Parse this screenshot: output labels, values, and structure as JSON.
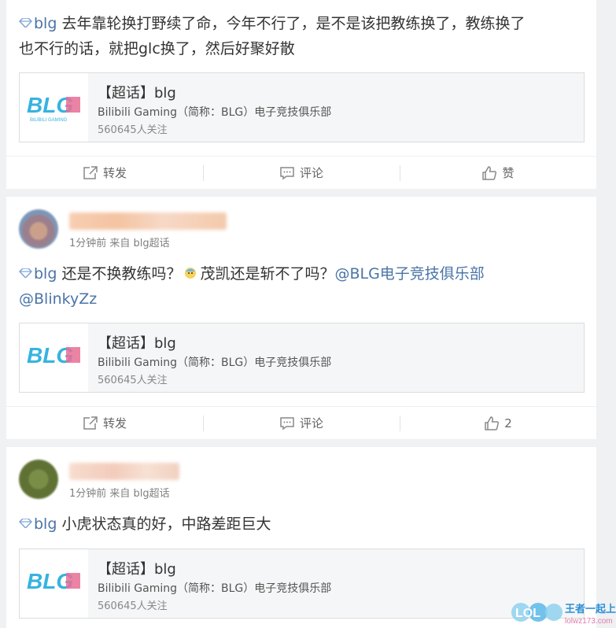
{
  "common": {
    "topic_name": "blg",
    "superchat_title": "【超话】blg",
    "superchat_desc": "Bilibili Gaming（简称：BLG）电子竞技俱乐部",
    "superchat_followers": "560645人关注",
    "logo_text": "BLG",
    "logo_sub": "BILIBILI GAMING",
    "repost_label": "转发",
    "comment_label": "评论",
    "like_label": "赞"
  },
  "posts": [
    {
      "text_line1": " 去年靠轮换打野续了命，今年不行了，是不是该把教练换了，教练换了",
      "text_line2": "也不行的话，就把glc换了，然后好聚好散",
      "like_count": "赞"
    },
    {
      "meta": "1分钟前 来自 blg超话",
      "text_part1": " 还是不换教练吗？",
      "text_part2": "茂凯还是斩不了吗？",
      "mention1": "@BLG电子竞技俱乐部",
      "mention2": "@BlinkyZz",
      "like_count": "2"
    },
    {
      "meta": "1分钟前 来自 blg超话",
      "text": " 小虎状态真的好，中路差距巨大"
    }
  ],
  "watermark": {
    "logo": "LOL",
    "title": "王者一起上",
    "url": "lolwz173.com"
  },
  "colors": {
    "link": "#4a74a7",
    "logo_blue": "#35b3e0",
    "logo_pink": "#e86d95"
  }
}
